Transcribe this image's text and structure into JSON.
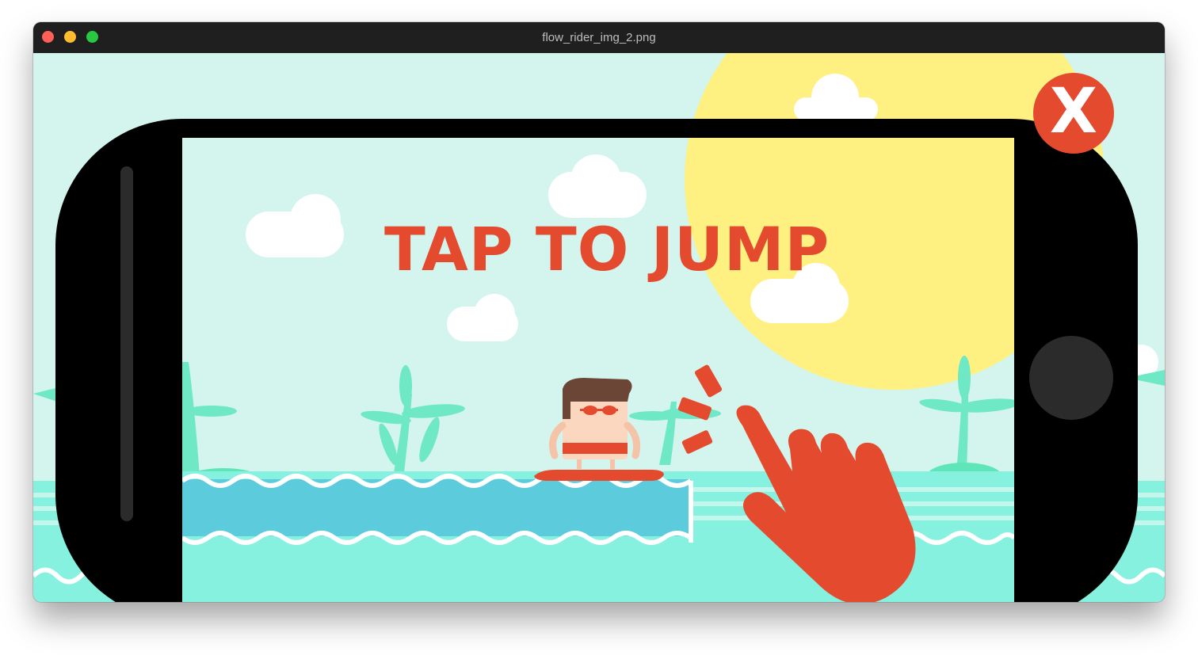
{
  "window": {
    "title": "flow_rider_img_2.png"
  },
  "game": {
    "instruction": "TAP TO JUMP",
    "close_label": "X",
    "character": "surfer-character",
    "pointer": "tap-hand-icon"
  },
  "colors": {
    "sky": "#d3f5ed",
    "sun": "#fef081",
    "cloud": "#ffffff",
    "palm": "#6fe8c6",
    "water_dark": "#5ccbdb",
    "water_light": "#86f1df",
    "accent_red": "#e44a2d",
    "phone_body": "#000000",
    "button_dark": "#2b2b2b"
  }
}
